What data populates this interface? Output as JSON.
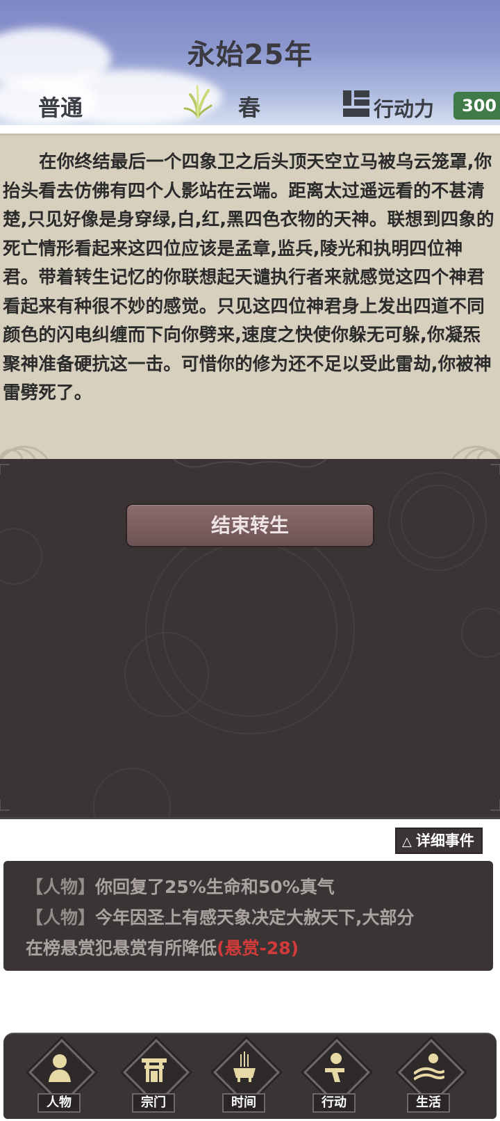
{
  "header": {
    "year": "永始25年",
    "difficulty": "普通",
    "season": "春",
    "action_points_label": "行动力",
    "action_points_value": "300"
  },
  "story": {
    "text": "在你终结最后一个四象卫之后头顶天空立马被乌云笼罩,你抬头看去仿佛有四个人影站在云端。距离太过遥远看的不甚清楚,只见好像是身穿绿,白,红,黑四色衣物的天神。联想到四象的死亡情形看起来这四位应该是孟章,监兵,陵光和执明四位神君。带着转生记忆的你联想起天谴执行者来就感觉这四个神君看起来有种很不妙的感觉。只见这四位神君身上发出四道不同颜色的闪电纠缠而下向你劈来,速度之快使你躲无可躲,你凝炁聚神准备硬抗这一击。可惜你的修为还不足以受此雷劫,你被神雷劈死了。"
  },
  "actions": {
    "end_rebirth": "结束转生",
    "detail_events": "详细事件"
  },
  "log": {
    "line1_tag": "【人物】",
    "line1_text": "你回复了25%生命和50%真气",
    "line2_tag": "【人物】",
    "line2_text": "今年因圣上有感天象决定大赦天下,大部分",
    "line3_text": "在榜悬赏犯悬赏有所降低",
    "line3_highlight": "(悬赏-28)"
  },
  "nav": [
    {
      "label": "人物",
      "icon": "person-icon"
    },
    {
      "label": "宗门",
      "icon": "gate-icon"
    },
    {
      "label": "时间",
      "icon": "incense-icon"
    },
    {
      "label": "行动",
      "icon": "action-icon"
    },
    {
      "label": "生活",
      "icon": "landscape-icon"
    }
  ],
  "colors": {
    "header_top": "#7f86c6",
    "story_bg": "#d7d0bf",
    "dark_bg": "#3a3435",
    "action_badge": "#3f7a48",
    "warning": "#d33b3b"
  }
}
